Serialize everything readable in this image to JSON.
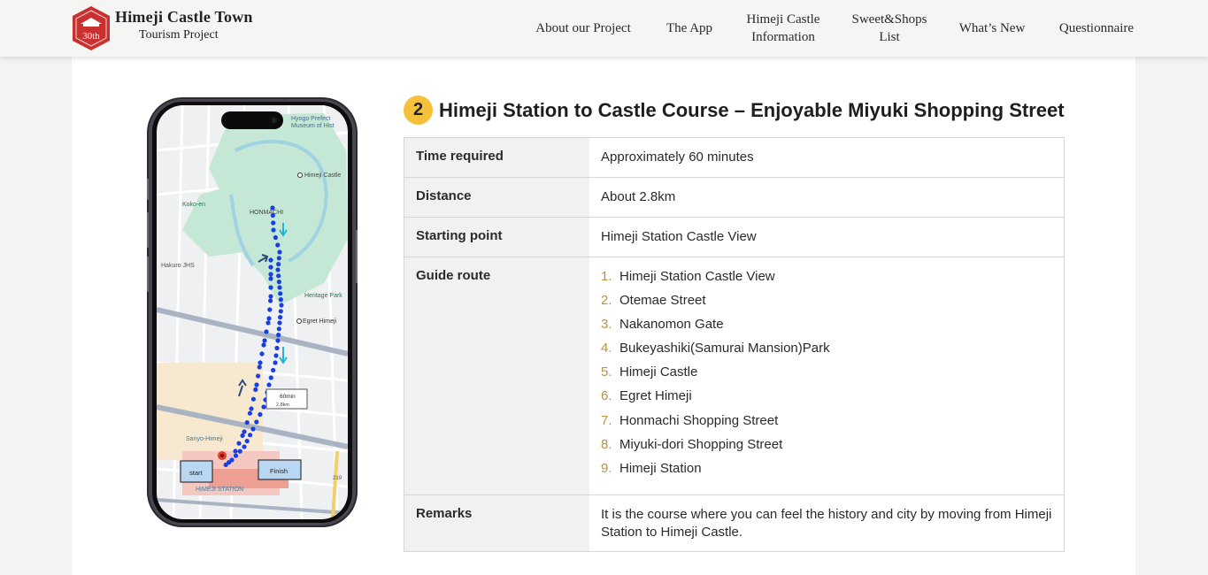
{
  "header": {
    "brand_line1": "Himeji Castle Town",
    "brand_line2": "Tourism Project",
    "logo_text": "30th",
    "nav": [
      {
        "label": "About our Project"
      },
      {
        "label": "The App"
      },
      {
        "label_line1": "Himeji Castle",
        "label_line2": "Information"
      },
      {
        "label_line1": "Sweet&Shops",
        "label_line2": "List"
      },
      {
        "label": "What’s New"
      },
      {
        "label": "Questionnaire"
      }
    ]
  },
  "course": {
    "number": "2",
    "title": "Himeji Station to Castle Course – Enjoyable Miyuki Shopping Street",
    "rows": {
      "time": {
        "label": "Time required",
        "value": "Approximately 60 minutes"
      },
      "distance": {
        "label": "Distance",
        "value": "About 2.8km"
      },
      "start": {
        "label": "Starting point",
        "value": "Himeji Station Castle View"
      },
      "route_label": "Guide route",
      "remarks": {
        "label": "Remarks",
        "value": "It is the course where you can feel the history and city by moving from Himeji Station to Himeji Castle."
      }
    },
    "route": [
      {
        "n": "1.",
        "name": "Himeji Station Castle View"
      },
      {
        "n": "2.",
        "name": "Otemae Street"
      },
      {
        "n": "3.",
        "name": "Nakanomon Gate"
      },
      {
        "n": "4.",
        "name": "Bukeyashiki(Samurai Mansion)Park"
      },
      {
        "n": "5.",
        "name": "Himeji Castle"
      },
      {
        "n": "6.",
        "name": "Egret Himeji"
      },
      {
        "n": "7.",
        "name": "Honmachi Shopping Street"
      },
      {
        "n": "8.",
        "name": "Miyuki-dori Shopping Street"
      },
      {
        "n": "9.",
        "name": "Himeji Station"
      }
    ]
  },
  "map": {
    "labels": {
      "museum1": "Hyogo Prefect",
      "museum2": "Museum of Hist",
      "castle": "Himeji Castle",
      "kokoen": "Koko-en",
      "honmachi": "HONMACHI",
      "hakuro": "Hakuro JHS",
      "heritage": "Heritage Park",
      "egret": "Egret Himeji",
      "sanyo": "Sanyo-Himeji",
      "station": "HIMEJI STATION",
      "start": "start",
      "finish": "Finish",
      "duration": "60min",
      "dist": "2.8km",
      "route_no": "219"
    }
  },
  "colors": {
    "accent": "#f6c13a",
    "route": "#1a3fe0",
    "park": "#c4e8d5",
    "water": "#9fd3e3"
  }
}
